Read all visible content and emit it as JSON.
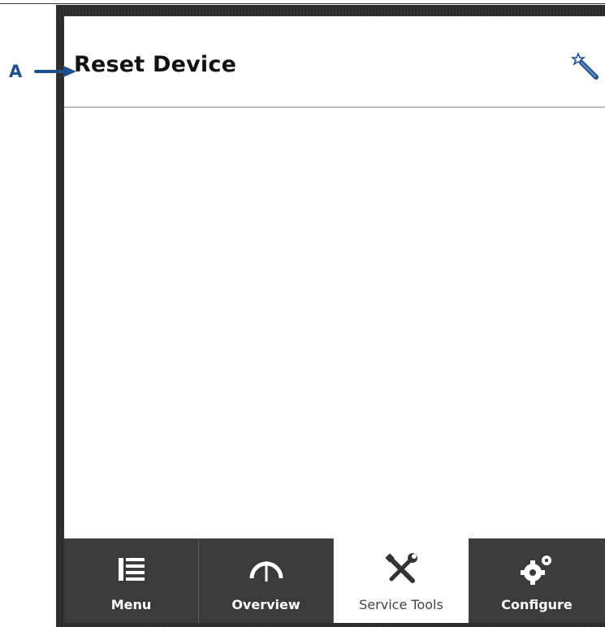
{
  "header": {
    "title": "Reset Device",
    "action_icon": "wand-icon"
  },
  "callout": {
    "label": "A"
  },
  "tabs": [
    {
      "label": "Menu",
      "icon": "menu-icon",
      "active": false
    },
    {
      "label": "Overview",
      "icon": "gauge-icon",
      "active": false
    },
    {
      "label": "Service Tools",
      "icon": "tools-icon",
      "active": true
    },
    {
      "label": "Configure",
      "icon": "gears-icon",
      "active": false
    }
  ],
  "colors": {
    "bezel": "#2b2b2b",
    "tab_inactive": "#3b3b3b",
    "tab_active": "#ffffff",
    "callout": "#1f4e8c"
  }
}
